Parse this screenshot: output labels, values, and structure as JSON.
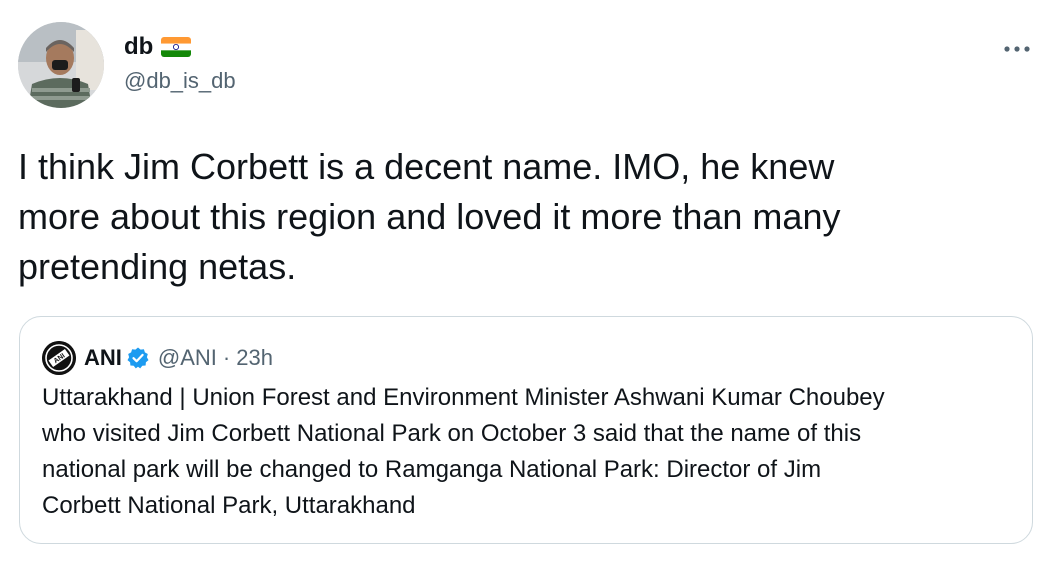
{
  "tweet": {
    "author": {
      "display_name": "db",
      "handle": "@db_is_db",
      "flag_icon": "india-flag-icon",
      "avatar_icon": "profile-photo-avatar"
    },
    "more_icon": "more-options-icon",
    "text": "I think Jim Corbett is a decent name. IMO, he knew\nmore about this region and loved it more than many\npretending netas."
  },
  "quote": {
    "author": {
      "display_name": "ANI",
      "handle": "@ANI",
      "separator": "·",
      "time": "23h",
      "logo_icon": "ani-logo-avatar",
      "verified_icon": "verified-badge-icon"
    },
    "text": "Uttarakhand | Union Forest and Environment Minister Ashwani Kumar Choubey\nwho visited Jim Corbett National Park on October 3 said that the name of this\nnational park will be changed to Ramganga National Park: Director of Jim\nCorbett National Park, Uttarakhand"
  },
  "colors": {
    "text_primary": "#0f1419",
    "text_secondary": "#536471",
    "border": "#cfd9de",
    "verified_blue": "#1d9bf0"
  }
}
